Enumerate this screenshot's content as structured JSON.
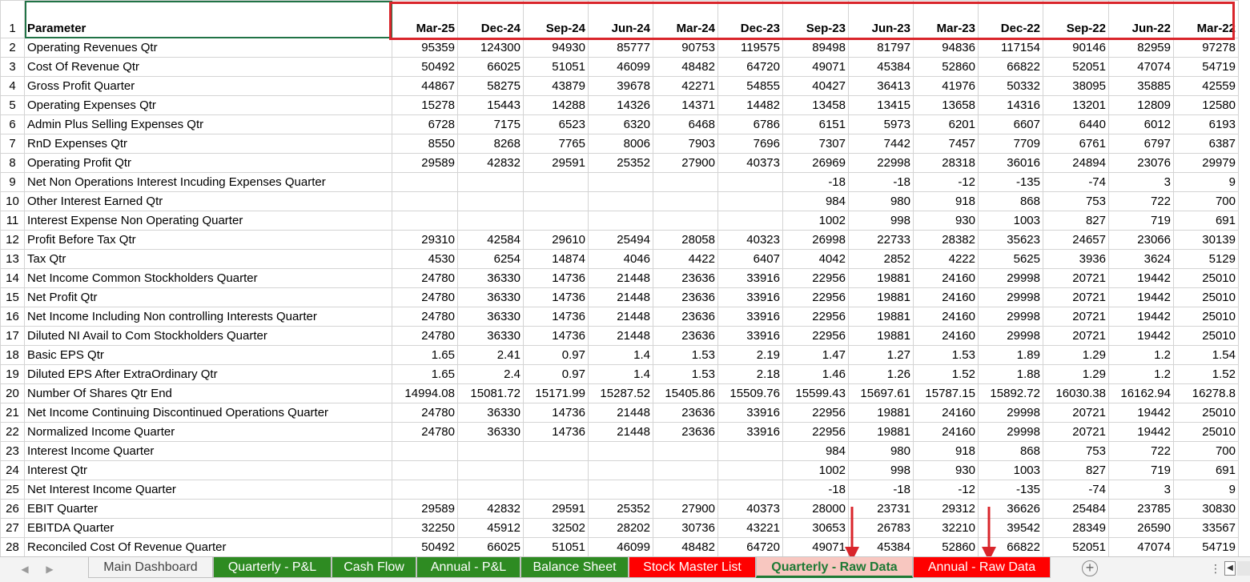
{
  "sheet": {
    "header_label": "Parameter",
    "columns": [
      "Mar-25",
      "Dec-24",
      "Sep-24",
      "Jun-24",
      "Mar-24",
      "Dec-23",
      "Sep-23",
      "Jun-23",
      "Mar-23",
      "Dec-22",
      "Sep-22",
      "Jun-22",
      "Mar-22"
    ],
    "rows": [
      {
        "num": "2",
        "label": "Operating Revenues Qtr",
        "values": [
          "95359",
          "124300",
          "94930",
          "85777",
          "90753",
          "119575",
          "89498",
          "81797",
          "94836",
          "117154",
          "90146",
          "82959",
          "97278"
        ]
      },
      {
        "num": "3",
        "label": "Cost Of Revenue Qtr",
        "values": [
          "50492",
          "66025",
          "51051",
          "46099",
          "48482",
          "64720",
          "49071",
          "45384",
          "52860",
          "66822",
          "52051",
          "47074",
          "54719"
        ]
      },
      {
        "num": "4",
        "label": "Gross Profit Quarter",
        "values": [
          "44867",
          "58275",
          "43879",
          "39678",
          "42271",
          "54855",
          "40427",
          "36413",
          "41976",
          "50332",
          "38095",
          "35885",
          "42559"
        ]
      },
      {
        "num": "5",
        "label": "Operating Expenses Qtr",
        "values": [
          "15278",
          "15443",
          "14288",
          "14326",
          "14371",
          "14482",
          "13458",
          "13415",
          "13658",
          "14316",
          "13201",
          "12809",
          "12580"
        ]
      },
      {
        "num": "6",
        "label": "Admin Plus Selling Expenses Qtr",
        "values": [
          "6728",
          "7175",
          "6523",
          "6320",
          "6468",
          "6786",
          "6151",
          "5973",
          "6201",
          "6607",
          "6440",
          "6012",
          "6193"
        ]
      },
      {
        "num": "7",
        "label": "RnD Expenses Qtr",
        "values": [
          "8550",
          "8268",
          "7765",
          "8006",
          "7903",
          "7696",
          "7307",
          "7442",
          "7457",
          "7709",
          "6761",
          "6797",
          "6387"
        ]
      },
      {
        "num": "8",
        "label": "Operating Profit Qtr",
        "values": [
          "29589",
          "42832",
          "29591",
          "25352",
          "27900",
          "40373",
          "26969",
          "22998",
          "28318",
          "36016",
          "24894",
          "23076",
          "29979"
        ]
      },
      {
        "num": "9",
        "label": "Net Non Operations Interest Incuding Expenses Quarter",
        "values": [
          "",
          "",
          "",
          "",
          "",
          "",
          "-18",
          "-18",
          "-12",
          "-135",
          "-74",
          "3",
          "9"
        ]
      },
      {
        "num": "10",
        "label": "Other Interest Earned Qtr",
        "values": [
          "",
          "",
          "",
          "",
          "",
          "",
          "984",
          "980",
          "918",
          "868",
          "753",
          "722",
          "700"
        ]
      },
      {
        "num": "11",
        "label": "Interest Expense Non Operating Quarter",
        "values": [
          "",
          "",
          "",
          "",
          "",
          "",
          "1002",
          "998",
          "930",
          "1003",
          "827",
          "719",
          "691"
        ]
      },
      {
        "num": "12",
        "label": "Profit Before Tax Qtr",
        "values": [
          "29310",
          "42584",
          "29610",
          "25494",
          "28058",
          "40323",
          "26998",
          "22733",
          "28382",
          "35623",
          "24657",
          "23066",
          "30139"
        ]
      },
      {
        "num": "13",
        "label": "Tax Qtr",
        "values": [
          "4530",
          "6254",
          "14874",
          "4046",
          "4422",
          "6407",
          "4042",
          "2852",
          "4222",
          "5625",
          "3936",
          "3624",
          "5129"
        ]
      },
      {
        "num": "14",
        "label": "Net Income Common Stockholders Quarter",
        "values": [
          "24780",
          "36330",
          "14736",
          "21448",
          "23636",
          "33916",
          "22956",
          "19881",
          "24160",
          "29998",
          "20721",
          "19442",
          "25010"
        ]
      },
      {
        "num": "15",
        "label": "Net Profit Qtr",
        "values": [
          "24780",
          "36330",
          "14736",
          "21448",
          "23636",
          "33916",
          "22956",
          "19881",
          "24160",
          "29998",
          "20721",
          "19442",
          "25010"
        ]
      },
      {
        "num": "16",
        "label": "Net Income Including Non controlling Interests Quarter",
        "values": [
          "24780",
          "36330",
          "14736",
          "21448",
          "23636",
          "33916",
          "22956",
          "19881",
          "24160",
          "29998",
          "20721",
          "19442",
          "25010"
        ]
      },
      {
        "num": "17",
        "label": "Diluted NI Avail to Com Stockholders Quarter",
        "values": [
          "24780",
          "36330",
          "14736",
          "21448",
          "23636",
          "33916",
          "22956",
          "19881",
          "24160",
          "29998",
          "20721",
          "19442",
          "25010"
        ]
      },
      {
        "num": "18",
        "label": "Basic EPS Qtr",
        "values": [
          "1.65",
          "2.41",
          "0.97",
          "1.4",
          "1.53",
          "2.19",
          "1.47",
          "1.27",
          "1.53",
          "1.89",
          "1.29",
          "1.2",
          "1.54"
        ]
      },
      {
        "num": "19",
        "label": "Diluted EPS After ExtraOrdinary Qtr",
        "values": [
          "1.65",
          "2.4",
          "0.97",
          "1.4",
          "1.53",
          "2.18",
          "1.46",
          "1.26",
          "1.52",
          "1.88",
          "1.29",
          "1.2",
          "1.52"
        ]
      },
      {
        "num": "20",
        "label": "Number Of Shares Qtr End",
        "values": [
          "14994.08",
          "15081.72",
          "15171.99",
          "15287.52",
          "15405.86",
          "15509.76",
          "15599.43",
          "15697.61",
          "15787.15",
          "15892.72",
          "16030.38",
          "16162.94",
          "16278.8"
        ]
      },
      {
        "num": "21",
        "label": "Net Income Continuing Discontinued Operations Quarter",
        "values": [
          "24780",
          "36330",
          "14736",
          "21448",
          "23636",
          "33916",
          "22956",
          "19881",
          "24160",
          "29998",
          "20721",
          "19442",
          "25010"
        ]
      },
      {
        "num": "22",
        "label": "Normalized Income Quarter",
        "values": [
          "24780",
          "36330",
          "14736",
          "21448",
          "23636",
          "33916",
          "22956",
          "19881",
          "24160",
          "29998",
          "20721",
          "19442",
          "25010"
        ]
      },
      {
        "num": "23",
        "label": "Interest Income Quarter",
        "values": [
          "",
          "",
          "",
          "",
          "",
          "",
          "984",
          "980",
          "918",
          "868",
          "753",
          "722",
          "700"
        ]
      },
      {
        "num": "24",
        "label": "Interest Qtr",
        "values": [
          "",
          "",
          "",
          "",
          "",
          "",
          "1002",
          "998",
          "930",
          "1003",
          "827",
          "719",
          "691"
        ]
      },
      {
        "num": "25",
        "label": "Net Interest Income Quarter",
        "values": [
          "",
          "",
          "",
          "",
          "",
          "",
          "-18",
          "-18",
          "-12",
          "-135",
          "-74",
          "3",
          "9"
        ]
      },
      {
        "num": "26",
        "label": "EBIT Quarter",
        "values": [
          "29589",
          "42832",
          "29591",
          "25352",
          "27900",
          "40373",
          "28000",
          "23731",
          "29312",
          "36626",
          "25484",
          "23785",
          "30830"
        ]
      },
      {
        "num": "27",
        "label": "EBITDA Quarter",
        "values": [
          "32250",
          "45912",
          "32502",
          "28202",
          "30736",
          "43221",
          "30653",
          "26783",
          "32210",
          "39542",
          "28349",
          "26590",
          "33567"
        ]
      },
      {
        "num": "28",
        "label": "Reconciled Cost Of Revenue Quarter",
        "values": [
          "50492",
          "66025",
          "51051",
          "46099",
          "48482",
          "64720",
          "49071",
          "45384",
          "52860",
          "66822",
          "52051",
          "47074",
          "54719"
        ]
      }
    ]
  },
  "tabs": [
    {
      "label": "Main Dashboard",
      "style": "plain"
    },
    {
      "label": "Quarterly - P&L",
      "style": "green"
    },
    {
      "label": "Cash Flow",
      "style": "green"
    },
    {
      "label": "Annual - P&L",
      "style": "green"
    },
    {
      "label": "Balance Sheet",
      "style": "green"
    },
    {
      "label": "Stock Master List",
      "style": "red"
    },
    {
      "label": "Quarterly - Raw Data",
      "style": "active"
    },
    {
      "label": "Annual - Raw Data",
      "style": "red"
    }
  ],
  "icons": {
    "nav_prev": "triangle-left-icon",
    "nav_next": "triangle-right-icon",
    "add_sheet": "plus-circle-icon",
    "more": "more-dots-icon",
    "scroll_left": "scroll-left-icon"
  },
  "colors": {
    "highlight": "#d9252b",
    "green_tab": "#2e8b22",
    "red_tab": "#ff0000",
    "active_tab": "#f8c7c0",
    "selection": "#217346"
  }
}
